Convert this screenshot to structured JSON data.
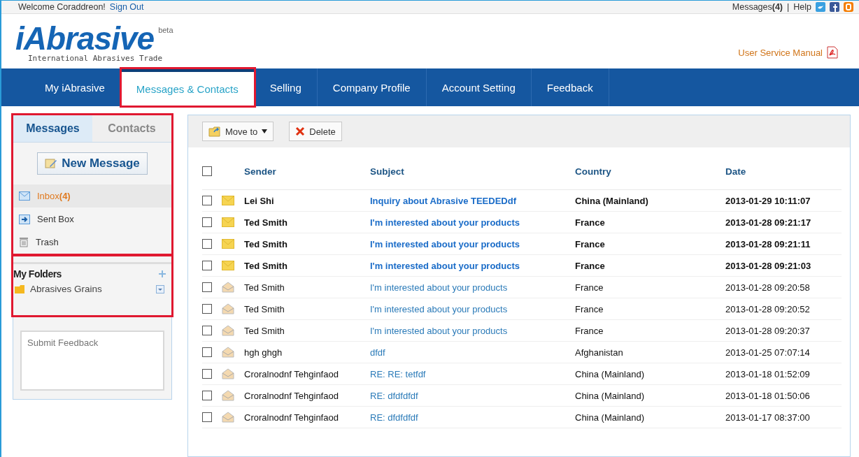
{
  "topbar": {
    "welcome": "Welcome Coraddreon!",
    "sign_out": "Sign Out",
    "messages_label": "Messages",
    "messages_count": "(4)",
    "separator": "|",
    "help": "Help"
  },
  "header": {
    "logo": "iAbrasive",
    "beta": "beta",
    "tagline": "International Abrasives Trade",
    "manual": "User Service Manual"
  },
  "nav": [
    {
      "label": "My iAbrasive",
      "selected": false,
      "highlighted": false
    },
    {
      "label": "Messages & Contacts",
      "selected": true,
      "highlighted": true
    },
    {
      "label": "Selling",
      "selected": false,
      "highlighted": false
    },
    {
      "label": "Company Profile",
      "selected": false,
      "highlighted": false
    },
    {
      "label": "Account Setting",
      "selected": false,
      "highlighted": false
    },
    {
      "label": "Feedback",
      "selected": false,
      "highlighted": false
    }
  ],
  "sidebar": {
    "highlighted": true,
    "tabs": [
      {
        "label": "Messages",
        "selected": true
      },
      {
        "label": "Contacts",
        "selected": false
      }
    ],
    "new_message": "New Message",
    "boxes": [
      {
        "kind": "inbox",
        "label": "Inbox",
        "count": "(4)",
        "selected": true
      },
      {
        "kind": "sent",
        "label": "Sent Box",
        "selected": false
      },
      {
        "kind": "trash",
        "label": "Trash",
        "selected": false
      }
    ],
    "folders": {
      "highlighted": true,
      "title": "My Folders",
      "items": [
        {
          "label": "Abrasives Grains"
        }
      ]
    },
    "feedback": {
      "placeholder": "Submit Feedback"
    }
  },
  "toolbar": {
    "move_to": "Move to",
    "delete": "Delete"
  },
  "table": {
    "select_all_checked": false,
    "columns": [
      "Sender",
      "Subject",
      "Country",
      "Date"
    ],
    "rows": [
      {
        "unread": true,
        "checked": false,
        "sender": "Lei Shi",
        "subject": "Inquiry about Abrasive TEEDEDdf",
        "country": "China (Mainland)",
        "date": "2013-01-29 10:11:07"
      },
      {
        "unread": true,
        "checked": false,
        "sender": "Ted Smith",
        "subject": "I'm interested about your products",
        "country": "France",
        "date": "2013-01-28 09:21:17"
      },
      {
        "unread": true,
        "checked": false,
        "sender": "Ted Smith",
        "subject": "I'm interested about your products",
        "country": "France",
        "date": "2013-01-28 09:21:11"
      },
      {
        "unread": true,
        "checked": false,
        "sender": "Ted Smith",
        "subject": "I'm interested about your products",
        "country": "France",
        "date": "2013-01-28 09:21:03"
      },
      {
        "unread": false,
        "checked": false,
        "sender": "Ted Smith",
        "subject": "I'm interested about your products",
        "country": "France",
        "date": "2013-01-28 09:20:58"
      },
      {
        "unread": false,
        "checked": false,
        "sender": "Ted Smith",
        "subject": "I'm interested about your products",
        "country": "France",
        "date": "2013-01-28 09:20:52"
      },
      {
        "unread": false,
        "checked": false,
        "sender": "Ted Smith",
        "subject": "I'm interested about your products",
        "country": "France",
        "date": "2013-01-28 09:20:37"
      },
      {
        "unread": false,
        "checked": false,
        "sender": "hgh ghgh",
        "subject": "dfdf",
        "country": "Afghanistan",
        "date": "2013-01-25 07:07:14"
      },
      {
        "unread": false,
        "checked": false,
        "sender": "Croralnodnf Tehginfaod",
        "subject": "RE: RE: tetfdf",
        "country": "China (Mainland)",
        "date": "2013-01-18 01:52:09"
      },
      {
        "unread": false,
        "checked": false,
        "sender": "Croralnodnf Tehginfaod",
        "subject": "RE: dfdfdfdf",
        "country": "China (Mainland)",
        "date": "2013-01-18 01:50:06"
      },
      {
        "unread": false,
        "checked": false,
        "sender": "Croralnodnf Tehginfaod",
        "subject": "RE: dfdfdfdf",
        "country": "China (Mainland)",
        "date": "2013-01-17 08:37:00"
      }
    ]
  }
}
